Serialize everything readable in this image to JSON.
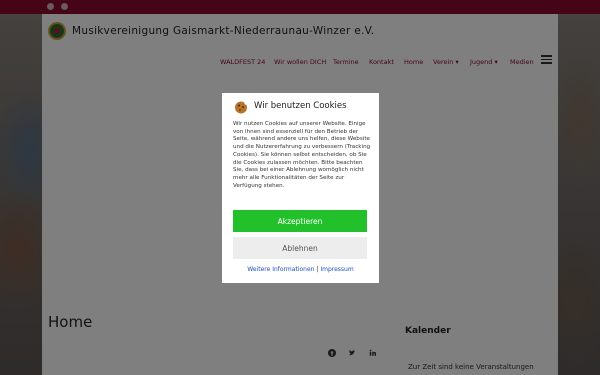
{
  "site": {
    "title": "Musikvereinigung Gaismarkt-Niederraunau-Winzer e.V."
  },
  "topbar": {
    "icons": [
      "facebook-icon",
      "instagram-icon"
    ]
  },
  "nav": {
    "items": [
      {
        "label": "WALDFEST 24"
      },
      {
        "label": "Wir wollen DICH"
      },
      {
        "label": "Termine"
      },
      {
        "label": "Kontakt"
      },
      {
        "label": "Home"
      },
      {
        "label": "Verein ▾"
      },
      {
        "label": "Jugend ▾"
      },
      {
        "label": "Medien"
      }
    ]
  },
  "content": {
    "title": "Home"
  },
  "sidebar": {
    "title": "Kalender",
    "text": "Zur Zeit sind keine Veranstaltungen"
  },
  "cookie_dialog": {
    "title": "Wir benutzen Cookies",
    "body": "Wir nutzen Cookies auf unserer Website. Einige von ihnen sind essenziell für den Betrieb der Seite, während andere uns helfen, diese Website und die Nutzererfahrung zu verbessern (Tracking Cookies). Sie können selbst entscheiden, ob Sie die Cookies zulassen möchten. Bitte beachten Sie, dass bei einer Ablehnung womöglich nicht mehr alle Funktionalitäten der Seite zur Verfügung stehen.",
    "accept_label": "Akzeptieren",
    "reject_label": "Ablehnen",
    "more_info_label": "Weitere Informationen",
    "separator": "|",
    "imprint_label": "Impressum"
  },
  "colors": {
    "brand": "#8b0a2e",
    "accept": "#22c02a",
    "link": "#1e4fc4"
  }
}
